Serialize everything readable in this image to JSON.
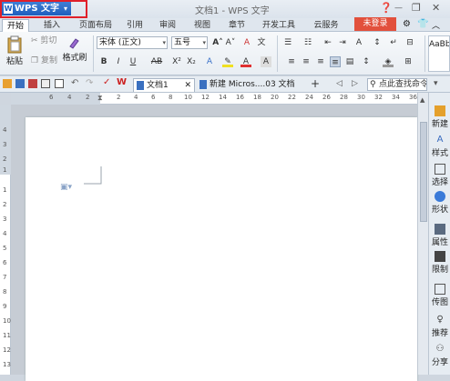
{
  "titlebar": {
    "app_button": "WPS 文字",
    "window_title": "文档1 - WPS 文字",
    "shirt_icon": "shirt-icon"
  },
  "menu_tabs": [
    "开始",
    "插入",
    "页面布局",
    "引用",
    "审阅",
    "视图",
    "章节",
    "开发工具",
    "云服务"
  ],
  "login_button": "未登录",
  "ribbon": {
    "paste": "粘贴",
    "cut": "剪切",
    "copy": "复制",
    "format_painter": "格式刷",
    "font_name": "宋体 (正文)",
    "font_size": "五号",
    "style_preview": "AaBb"
  },
  "quickbar": {
    "doc_tab_1": "文档1",
    "doc_tab_2": "新建 Micros....03 文档 (2)",
    "add_tab": "+",
    "search_text": "点此查找命令"
  },
  "ruler": {
    "h_ticks_left": [
      "6",
      "4",
      "2"
    ],
    "h_ticks_right": [
      "2",
      "4",
      "6",
      "8",
      "10",
      "12",
      "14",
      "16",
      "18",
      "20",
      "22",
      "24",
      "26",
      "28",
      "30",
      "32",
      "34",
      "36",
      "38"
    ],
    "v_ticks": [
      "4",
      "3",
      "2",
      "1",
      "1",
      "2",
      "3",
      "4",
      "5",
      "6",
      "7",
      "8",
      "9",
      "10",
      "11",
      "12",
      "13",
      "14"
    ]
  },
  "side_pane": [
    "新建",
    "样式",
    "选择",
    "形状",
    "属性",
    "限制",
    "传图",
    "推荐",
    "分享"
  ],
  "colors": {
    "accent": "#1f5fbd",
    "login_bg": "#e2503c",
    "highlight": "#e0202a"
  }
}
